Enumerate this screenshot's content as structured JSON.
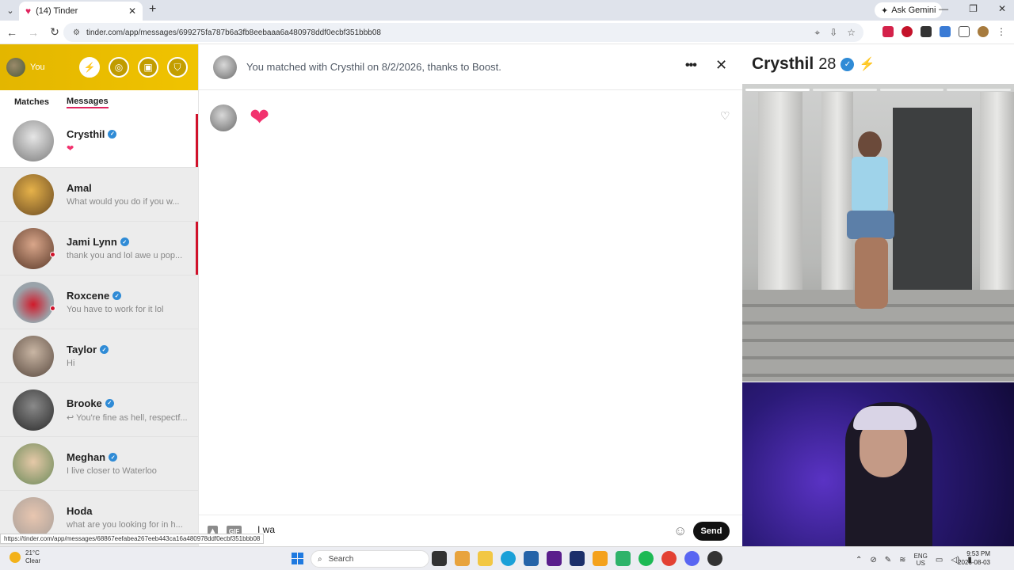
{
  "browser": {
    "tab_title": "(14) Tinder",
    "url": "tinder.com/app/messages/699275fa787b6a3fb8eebaaa6a480978ddf0ecbf351bbb08",
    "gemini_label": "Ask Gemini",
    "status_url": "https://tinder.com/app/messages/68867eefabea267eeb443ca16a480978ddf0ecbf351bbb08"
  },
  "sidebar": {
    "me_label": "You",
    "tabs": {
      "matches": "Matches",
      "messages": "Messages"
    },
    "conversations": [
      {
        "name": "Crysthil",
        "verified": true,
        "preview": "❤",
        "active": true,
        "unread": true
      },
      {
        "name": "Amal",
        "verified": false,
        "preview": "What would you do if you w...",
        "unread": false
      },
      {
        "name": "Jami Lynn",
        "verified": true,
        "preview": "thank you and lol awe u pop...",
        "unread": true,
        "online": true
      },
      {
        "name": "Roxcene",
        "verified": true,
        "preview": "You have to work for it lol",
        "unread": false,
        "online": true
      },
      {
        "name": "Taylor",
        "verified": true,
        "preview": "Hi",
        "unread": false
      },
      {
        "name": "Brooke",
        "verified": true,
        "preview": "↩ You're fine as hell, respectf...",
        "unread": false
      },
      {
        "name": "Meghan",
        "verified": true,
        "preview": "I live closer to Waterloo",
        "unread": false
      },
      {
        "name": "Hoda",
        "verified": false,
        "preview": "what are you looking for in h...",
        "unread": false
      }
    ]
  },
  "chat": {
    "match_text": "You matched with Crysthil on 8/2/2026, thanks to Boost.",
    "message_emoji": "❤",
    "input_value": "I wa",
    "gif_label": "GIF",
    "send_label": "Send"
  },
  "profile": {
    "name": "Crysthil",
    "age": "28"
  },
  "taskbar": {
    "temperature": "21°C",
    "condition": "Clear",
    "search_placeholder": "Search",
    "lang_top": "ENG",
    "lang_bottom": "US",
    "time": "9:53 PM",
    "date": "2026-08-03"
  },
  "colors": {
    "tinder_accent": "#e0245e",
    "header_yellow": "#f0c300",
    "verified_blue": "#2f8bd6",
    "boost_purple": "#b178f5",
    "unread_red": "#d0122b"
  }
}
